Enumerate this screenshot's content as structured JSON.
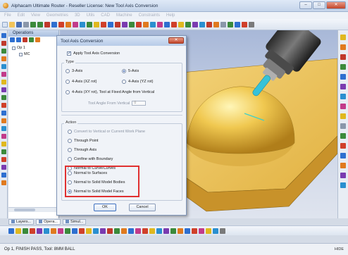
{
  "window": {
    "title": "Alphacam Ultimate Router - Reseller License: New Tool Axis Conversion",
    "buttons": {
      "minimize": "–",
      "maximize": "□",
      "close": "✕"
    }
  },
  "menubar": [
    "File",
    "Edit",
    "View",
    "Geometries",
    "3D",
    "Utils",
    "CAD",
    "Machine",
    "Constraints",
    "Help"
  ],
  "operations_panel": {
    "title": "Operations",
    "tree": [
      {
        "label": "Op 1"
      },
      {
        "label": "MC"
      }
    ]
  },
  "bottom_tabs": [
    "Layers...",
    "Opera...",
    "Simul..."
  ],
  "dialog": {
    "title": "Tool Axis Conversion",
    "close_label": "✕",
    "apply_label": "Apply Tool Axis Conversion",
    "apply_checked": true,
    "type_group": "Type",
    "types": [
      {
        "label": "3-Axis",
        "selected": false
      },
      {
        "label": "5-Axis",
        "selected": true
      },
      {
        "label": "4-Axis (XZ rot)",
        "selected": false
      },
      {
        "label": "4-Axis (YZ rot)",
        "selected": false
      },
      {
        "label": "4-Axis (XY rot), Tool at Fixed Angle from Vertical",
        "selected": false
      }
    ],
    "angle_label": "Tool Angle From Vertical",
    "angle_value": "0",
    "action_group": "Action",
    "actions": [
      {
        "label": "Convert to Vertical or Current Work Plane",
        "selected": false,
        "enabled": false
      },
      {
        "label": "Through Point",
        "selected": false,
        "enabled": true
      },
      {
        "label": "Through Axis",
        "selected": false,
        "enabled": true
      },
      {
        "label": "Confine with Boundary",
        "selected": false,
        "enabled": true
      },
      {
        "label": "Normal to Curve/Curves",
        "selected": false,
        "enabled": true
      },
      {
        "label": "Normal to Surfaces",
        "selected": false,
        "enabled": true
      },
      {
        "label": "Normal to Solid Model Bodies",
        "selected": false,
        "enabled": true
      },
      {
        "label": "Normal to Solid Model Faces",
        "selected": true,
        "enabled": true
      }
    ],
    "ok_label": "OK",
    "cancel_label": "Cancel"
  },
  "status": {
    "left": "Op 1, FINISH PASS, Tool: 8MM BALL",
    "right": "HIDE"
  },
  "colors": {
    "accent": "#3d6fbf",
    "highlight": "#e03030",
    "part": "#e8b845"
  }
}
